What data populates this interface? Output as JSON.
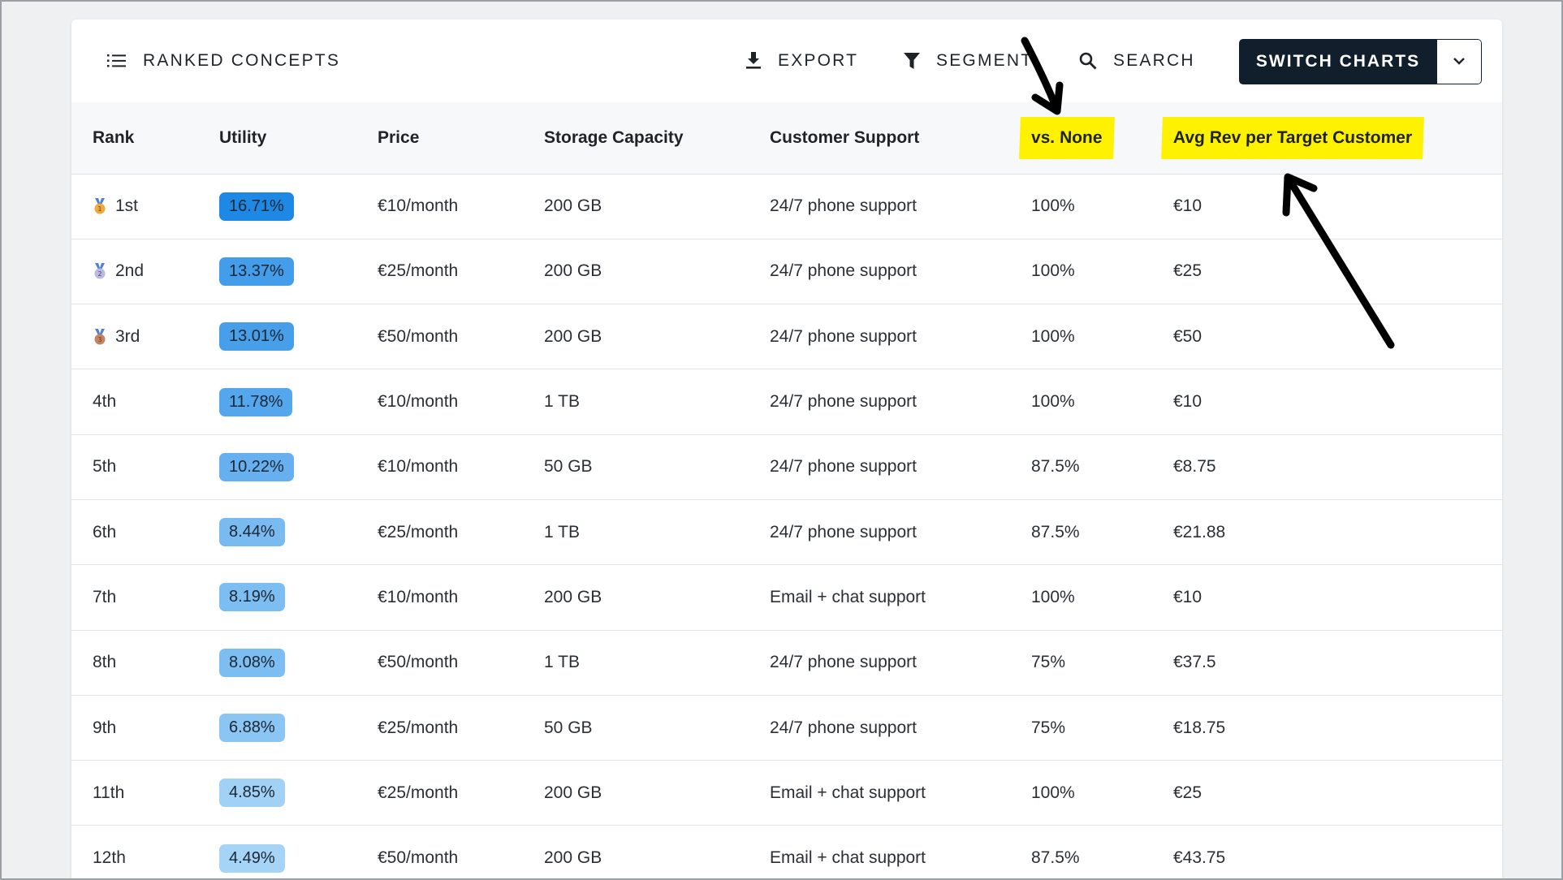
{
  "toolbar": {
    "title": "RANKED CONCEPTS",
    "export_label": "EXPORT",
    "segment_label": "SEGMENT",
    "search_label": "SEARCH",
    "switch_label": "SWITCH CHARTS"
  },
  "columns": {
    "rank": "Rank",
    "utility": "Utility",
    "price": "Price",
    "storage": "Storage Capacity",
    "support": "Customer Support",
    "vs_none": "vs. None",
    "avg_rev": "Avg Rev per Target Customer"
  },
  "rows": [
    {
      "rank": "1st",
      "medal": "gold",
      "utility": "16.71%",
      "utility_value": 16.71,
      "price": "€10/month",
      "storage": "200 GB",
      "support": "24/7 phone support",
      "vs_none": "100%",
      "avg_rev": "€10"
    },
    {
      "rank": "2nd",
      "medal": "silver",
      "utility": "13.37%",
      "utility_value": 13.37,
      "price": "€25/month",
      "storage": "200 GB",
      "support": "24/7 phone support",
      "vs_none": "100%",
      "avg_rev": "€25"
    },
    {
      "rank": "3rd",
      "medal": "bronze",
      "utility": "13.01%",
      "utility_value": 13.01,
      "price": "€50/month",
      "storage": "200 GB",
      "support": "24/7 phone support",
      "vs_none": "100%",
      "avg_rev": "€50"
    },
    {
      "rank": "4th",
      "medal": "",
      "utility": "11.78%",
      "utility_value": 11.78,
      "price": "€10/month",
      "storage": "1 TB",
      "support": "24/7 phone support",
      "vs_none": "100%",
      "avg_rev": "€10"
    },
    {
      "rank": "5th",
      "medal": "",
      "utility": "10.22%",
      "utility_value": 10.22,
      "price": "€10/month",
      "storage": "50 GB",
      "support": "24/7 phone support",
      "vs_none": "87.5%",
      "avg_rev": "€8.75"
    },
    {
      "rank": "6th",
      "medal": "",
      "utility": "8.44%",
      "utility_value": 8.44,
      "price": "€25/month",
      "storage": "1 TB",
      "support": "24/7 phone support",
      "vs_none": "87.5%",
      "avg_rev": "€21.88"
    },
    {
      "rank": "7th",
      "medal": "",
      "utility": "8.19%",
      "utility_value": 8.19,
      "price": "€10/month",
      "storage": "200 GB",
      "support": "Email + chat support",
      "vs_none": "100%",
      "avg_rev": "€10"
    },
    {
      "rank": "8th",
      "medal": "",
      "utility": "8.08%",
      "utility_value": 8.08,
      "price": "€50/month",
      "storage": "1 TB",
      "support": "24/7 phone support",
      "vs_none": "75%",
      "avg_rev": "€37.5"
    },
    {
      "rank": "9th",
      "medal": "",
      "utility": "6.88%",
      "utility_value": 6.88,
      "price": "€25/month",
      "storage": "50 GB",
      "support": "24/7 phone support",
      "vs_none": "75%",
      "avg_rev": "€18.75"
    },
    {
      "rank": "11th",
      "medal": "",
      "utility": "4.85%",
      "utility_value": 4.85,
      "price": "€25/month",
      "storage": "200 GB",
      "support": "Email + chat support",
      "vs_none": "100%",
      "avg_rev": "€25"
    },
    {
      "rank": "12th",
      "medal": "",
      "utility": "4.49%",
      "utility_value": 4.49,
      "price": "€50/month",
      "storage": "200 GB",
      "support": "Email + chat support",
      "vs_none": "87.5%",
      "avg_rev": "€43.75"
    }
  ],
  "colors": {
    "highlight": "#fff200",
    "button_dark": "#101f2b",
    "badge_max": "#1e88e5",
    "badge_min": "#a5d4f7",
    "medal_gold": "#f0a83a",
    "medal_silver": "#b9b8e6",
    "medal_bronze": "#c48462"
  },
  "icons": {
    "title": "list-numbered-icon",
    "export": "download-icon",
    "segment": "filter-icon",
    "search": "search-icon",
    "dropdown": "chevron-down-icon"
  }
}
